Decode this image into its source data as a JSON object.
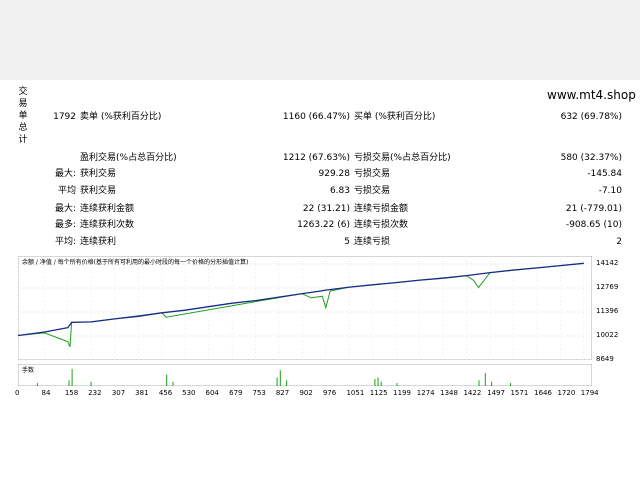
{
  "header": {
    "vertical_label": "交易单总计",
    "site": "www.mt4.shop"
  },
  "stats": {
    "row1": {
      "total": "1792",
      "l1": "卖单 (%获利百分比)",
      "v1": "1160 (66.47%)",
      "l2": "买单 (%获利百分比)",
      "v2": "632 (69.78%)"
    },
    "row2": {
      "l1": "盈利交易(%占总百分比)",
      "v1": "1212 (67.63%)",
      "l2": "亏损交易(%占总百分比)",
      "v2": "580 (32.37%)"
    },
    "row3": {
      "p": "最大:",
      "l1": "获利交易",
      "v1": "929.28",
      "l2": "亏损交易",
      "v2": "-145.84"
    },
    "row4": {
      "p": "平均",
      "l1": "获利交易",
      "v1": "6.83",
      "l2": "亏损交易",
      "v2": "-7.10"
    },
    "row5": {
      "p": "最大:",
      "l1": "连续获利金额",
      "v1": "22 (31.21)",
      "l2": "连续亏损金额",
      "v2": "21 (-779.01)"
    },
    "row6": {
      "p": "最多:",
      "l1": "连续获利次数",
      "v1": "1263.22 (6)",
      "l2": "连续亏损次数",
      "v2": "-908.65 (10)"
    },
    "row7": {
      "p": "平均:",
      "l1": "连续获利",
      "v1": "5",
      "l2": "连续亏损",
      "v2": "2"
    }
  },
  "chart": {
    "legend": "余额 / 净值 / 每个所有价格(基于所有可利用的最小时段的每一个价格的分形插值计算)",
    "vol_label": "手数",
    "colors": {
      "balance": "#1a2a8c",
      "equity": "#1aa01a"
    }
  },
  "chart_data": {
    "type": "line",
    "xlabel": "",
    "ylabel": "",
    "xlim": [
      0,
      1820
    ],
    "ylim": [
      8649,
      14600
    ],
    "y_ticks": [
      "14142",
      "12769",
      "11396",
      "10022",
      "8649"
    ],
    "x_ticks": [
      "0",
      "84",
      "158",
      "232",
      "307",
      "381",
      "456",
      "530",
      "604",
      "679",
      "753",
      "827",
      "902",
      "976",
      "1051",
      "1125",
      "1199",
      "1274",
      "1348",
      "1422",
      "1497",
      "1571",
      "1646",
      "1720",
      "1794"
    ],
    "series": [
      {
        "x": [
          0,
          84,
          158,
          170,
          232,
          307,
          381,
          456,
          530,
          604,
          679,
          753,
          827,
          902,
          960,
          976,
          1051,
          1125,
          1199,
          1274,
          1348,
          1422,
          1497,
          1571,
          1646,
          1720,
          1794
        ],
        "values": [
          10050,
          10250,
          10500,
          10800,
          10830,
          11000,
          11150,
          11350,
          11500,
          11700,
          11900,
          12050,
          12250,
          12450,
          12600,
          12650,
          12820,
          12950,
          13080,
          13220,
          13330,
          13480,
          13650,
          13800,
          13920,
          14050,
          14180
        ]
      },
      {
        "x": [
          0,
          84,
          158,
          165,
          170,
          232,
          456,
          470,
          900,
          930,
          965,
          976,
          990,
          1051,
          1422,
          1445,
          1460,
          1497,
          1794
        ],
        "values": [
          10050,
          10200,
          9700,
          9400,
          10800,
          10830,
          11350,
          11100,
          12450,
          12200,
          12300,
          11650,
          12600,
          12820,
          13480,
          13200,
          12800,
          13650,
          14180
        ]
      }
    ],
    "volume": {
      "x": [
        60,
        160,
        170,
        230,
        470,
        490,
        820,
        830,
        850,
        1130,
        1140,
        1150,
        1200,
        1460,
        1480,
        1500,
        1560
      ],
      "values": [
        2,
        4,
        12,
        3,
        8,
        3,
        6,
        11,
        4,
        5,
        6,
        3,
        2,
        4,
        9,
        3,
        2
      ]
    }
  }
}
